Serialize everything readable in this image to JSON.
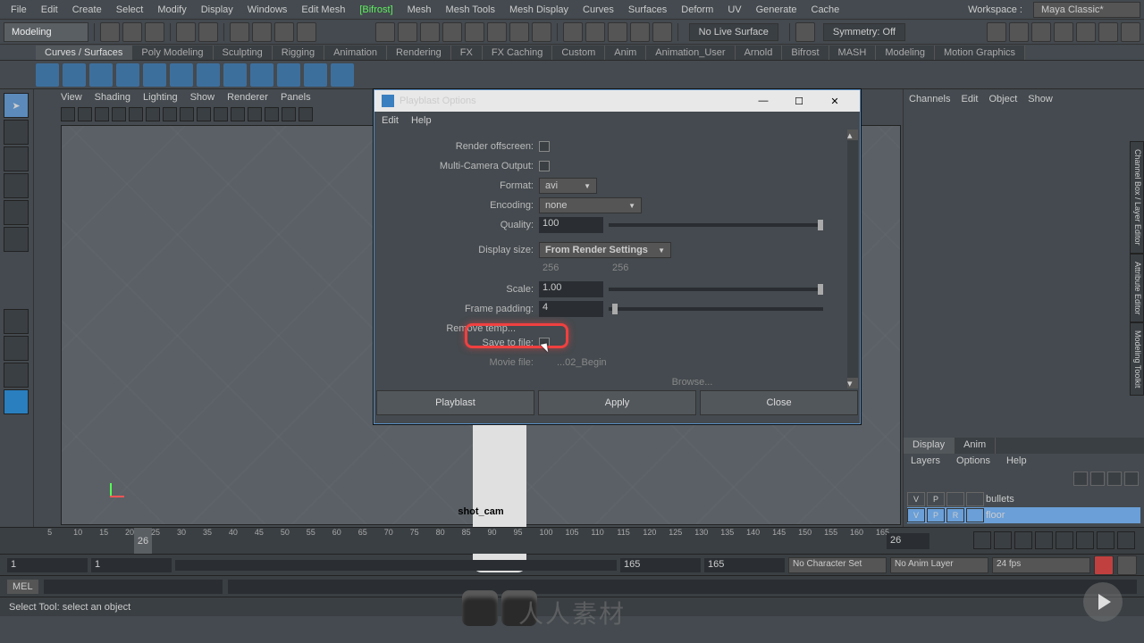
{
  "menubar": [
    "File",
    "Edit",
    "Create",
    "Select",
    "Modify",
    "Display",
    "Windows",
    "Edit Mesh",
    "[Bifrost]",
    "Mesh",
    "Mesh Tools",
    "Mesh Display",
    "Curves",
    "Surfaces",
    "Deform",
    "UV",
    "Generate",
    "Cache"
  ],
  "workspace": {
    "label": "Workspace :",
    "value": "Maya Classic*"
  },
  "mode": "Modeling",
  "no_live": "No Live Surface",
  "symmetry": "Symmetry: Off",
  "shelf_tabs": [
    "Curves / Surfaces",
    "Poly Modeling",
    "Sculpting",
    "Rigging",
    "Animation",
    "Rendering",
    "FX",
    "FX Caching",
    "Custom",
    "Anim",
    "Animation_User",
    "Arnold",
    "Bifrost",
    "MASH",
    "Modeling",
    "Motion Graphics"
  ],
  "vp_menu": [
    "View",
    "Shading",
    "Lighting",
    "Show",
    "Renderer",
    "Panels"
  ],
  "cam_label": "shot_cam",
  "right_menu": [
    "Channels",
    "Edit",
    "Object",
    "Show"
  ],
  "display_tabs": {
    "display": "Display",
    "anim": "Anim"
  },
  "layers_sub": [
    "Layers",
    "Options",
    "Help"
  ],
  "layers": [
    {
      "v": "V",
      "p": "P",
      "r": "",
      "name": "bullets",
      "sel": false
    },
    {
      "v": "V",
      "p": "P",
      "r": "R",
      "name": "floor",
      "sel": true
    }
  ],
  "timeline": {
    "start": 5,
    "end": 165,
    "current": 26,
    "current_display": "26"
  },
  "range": {
    "start_outer": "1",
    "start_inner": "1",
    "end_inner": "165",
    "end_outer": "165",
    "char_set": "No Character Set",
    "anim_layer": "No Anim Layer",
    "fps": "24 fps"
  },
  "cmd": {
    "label": "MEL"
  },
  "status": "Select Tool: select an object",
  "dialog": {
    "title": "Playblast Options",
    "menus": [
      "Edit",
      "Help"
    ],
    "render_offscreen": "Render offscreen:",
    "multi_cam": "Multi-Camera Output:",
    "format_label": "Format:",
    "format": "avi",
    "encoding_label": "Encoding:",
    "encoding": "none",
    "quality_label": "Quality:",
    "quality": "100",
    "display_size_label": "Display size:",
    "display_size": "From Render Settings",
    "size_w": "256",
    "size_h": "256",
    "scale_label": "Scale:",
    "scale": "1.00",
    "padding_label": "Frame padding:",
    "padding": "4",
    "remove_temp": "Remove temp...",
    "save_to_file": "Save to file:",
    "movie_file_label": "Movie file:",
    "movie_file": "...02_Begin",
    "browse": "Browse...",
    "buttons": {
      "playblast": "Playblast",
      "apply": "Apply",
      "close": "Close"
    }
  },
  "watermark": "人人素材",
  "vtabs": [
    "Channel Box / Layer Editor",
    "Attribute Editor",
    "Modeling Toolkit"
  ]
}
